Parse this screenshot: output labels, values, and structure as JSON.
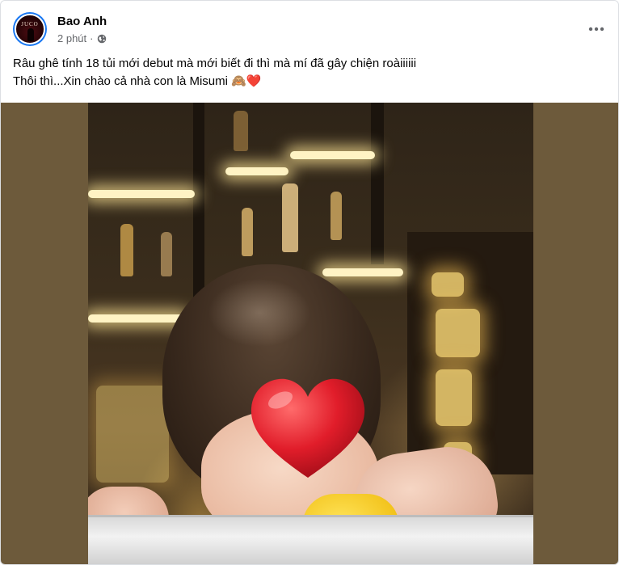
{
  "post": {
    "author_name": "Bao Anh",
    "avatar_text": "JUCO",
    "timestamp": "2 phút",
    "separator": "·",
    "privacy_icon": "globe-icon",
    "more_icon": "more-options-icon",
    "text_line1": "Râu ghê tính 18 tủi mới debut mà mới biết đi thì mà mí đã gây chiện roàiiiiii",
    "text_line2": "Thôi thì...Xin chào cả nhà con là Misumi 🙈❤️"
  },
  "colors": {
    "accent": "#1877f2",
    "secondary_text": "#65676b",
    "heart": "#e11d2a"
  }
}
